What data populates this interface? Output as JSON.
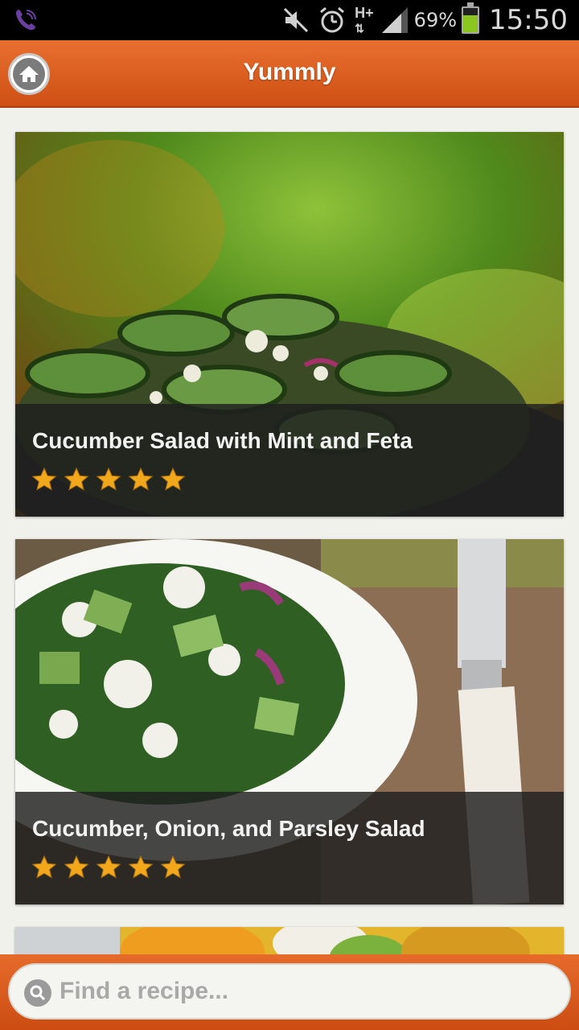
{
  "status_bar": {
    "battery_percent_label": "69%",
    "battery_level": 0.69,
    "network": "H+",
    "time": "15:50",
    "icons": [
      "viber-call-icon",
      "mute-icon",
      "alarm-icon",
      "network-hplus-icon",
      "signal-icon",
      "battery-icon"
    ]
  },
  "header": {
    "title": "Yummly",
    "home_icon": "home-icon"
  },
  "recipes": [
    {
      "title": "Cucumber Salad with Mint and Feta",
      "rating": 5,
      "image": "cucumber-mint-feta-photo"
    },
    {
      "title": "Cucumber, Onion, and Parsley Salad",
      "rating": 5,
      "image": "cucumber-onion-parsley-photo"
    },
    {
      "title": "",
      "rating": 0,
      "image": "salad-photo-partial"
    }
  ],
  "search": {
    "placeholder": "Find a recipe...",
    "value": ""
  },
  "colors": {
    "accent": "#e0612a",
    "star": "#f2a81d"
  }
}
